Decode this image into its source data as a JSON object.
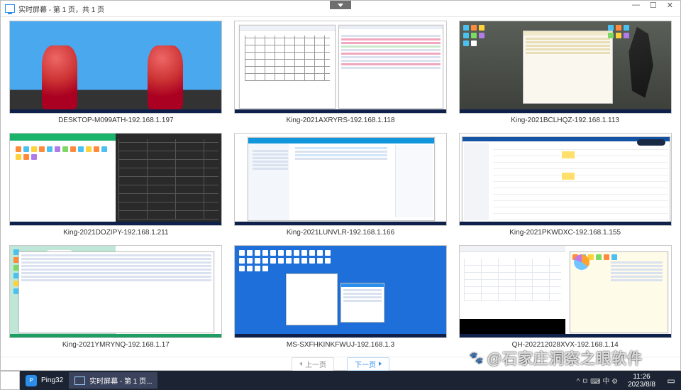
{
  "window": {
    "title": "实时屏幕 - 第 1 页，共 1 页",
    "min": "—",
    "max": "☐",
    "close": "✕"
  },
  "thumbs": [
    {
      "caption": "DESKTOP-M099ATH-192.168.1.197"
    },
    {
      "caption": "King-2021AXRYRS-192.168.1.118"
    },
    {
      "caption": "King-2021BCLHQZ-192.168.1.113"
    },
    {
      "caption": "King-2021DOZIPY-192.168.1.211"
    },
    {
      "caption": "King-2021LUNVLR-192.168.1.166"
    },
    {
      "caption": "King-2021PKWDXC-192.168.1.155"
    },
    {
      "caption": "King-2021YMRYNQ-192.168.1.17"
    },
    {
      "caption": "MS-SXFHKINKFWUJ-192.168.1.3"
    },
    {
      "caption": "QH-202212028XVX-192.168.1.14"
    }
  ],
  "pager": {
    "prev": "上一页",
    "next": "下一页"
  },
  "taskbar": {
    "app1": "Ping32",
    "app2": "实时屏幕 - 第 1 页...",
    "tray": "^  ㅁ ⌨ 中 ⚙",
    "time": "11:26",
    "date": "2023/8/8"
  },
  "watermark": "@石家庄洞察之眼软件"
}
